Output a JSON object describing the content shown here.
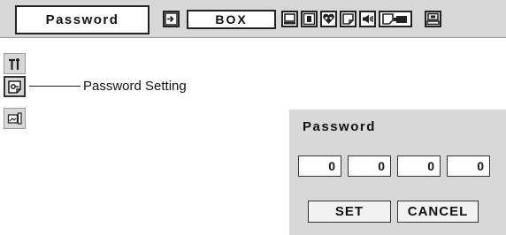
{
  "menu": {
    "title": "Password",
    "source_value": "BOX",
    "icons": [
      "input-icon",
      "screen-icon",
      "image-select-icon",
      "image-adjust-icon",
      "display-settings-icon",
      "sound-icon",
      "pc-adjust-icon",
      "setting-icon"
    ]
  },
  "side_menu": {
    "icons": [
      "setting-tool-icon",
      "password-icon",
      "screen-image-icon"
    ],
    "callout_label": "Password Setting"
  },
  "dialog": {
    "title": "Password",
    "digits": [
      "0",
      "0",
      "0",
      "0"
    ],
    "set_label": "SET",
    "cancel_label": "CANCEL"
  }
}
